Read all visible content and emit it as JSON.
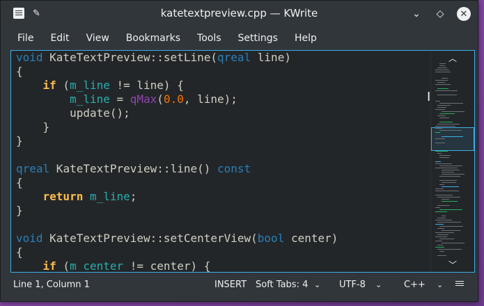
{
  "window": {
    "title": "katetextpreview.cpp  — KWrite",
    "icons": [
      "app-icon",
      "pin-icon",
      "chevron-down-icon",
      "restore-icon",
      "close-icon"
    ]
  },
  "menubar": {
    "items": [
      "File",
      "Edit",
      "View",
      "Bookmarks",
      "Tools",
      "Settings",
      "Help"
    ]
  },
  "editor": {
    "accent": "#3daee9",
    "lines": [
      [
        [
          "kw-blue",
          "void"
        ],
        [
          "plain",
          " KateTextPreview::setLine("
        ],
        [
          "kw-blue",
          "qreal"
        ],
        [
          "plain",
          " line)"
        ]
      ],
      [
        [
          "plain",
          "{"
        ]
      ],
      [
        [
          "plain",
          "    "
        ],
        [
          "kw-orange",
          "if"
        ],
        [
          "plain",
          " ("
        ],
        [
          "var",
          "m_line"
        ],
        [
          "plain",
          " != line) {"
        ]
      ],
      [
        [
          "plain",
          "        "
        ],
        [
          "var",
          "m_line"
        ],
        [
          "plain",
          " = "
        ],
        [
          "fn-purple",
          "qMax"
        ],
        [
          "plain",
          "("
        ],
        [
          "num",
          "0.0"
        ],
        [
          "plain",
          ", line);"
        ]
      ],
      [
        [
          "plain",
          "        update();"
        ]
      ],
      [
        [
          "plain",
          "    }"
        ]
      ],
      [
        [
          "plain",
          "}"
        ]
      ],
      [
        [
          "plain",
          ""
        ]
      ],
      [
        [
          "kw-blue",
          "qreal"
        ],
        [
          "plain",
          " KateTextPreview::line() "
        ],
        [
          "kw-blue",
          "const"
        ]
      ],
      [
        [
          "plain",
          "{"
        ]
      ],
      [
        [
          "plain",
          "    "
        ],
        [
          "kw-orange",
          "return"
        ],
        [
          "plain",
          " "
        ],
        [
          "var",
          "m_line"
        ],
        [
          "plain",
          ";"
        ]
      ],
      [
        [
          "plain",
          "}"
        ]
      ],
      [
        [
          "plain",
          ""
        ]
      ],
      [
        [
          "kw-blue",
          "void"
        ],
        [
          "plain",
          " KateTextPreview::setCenterView("
        ],
        [
          "kw-blue",
          "bool"
        ],
        [
          "plain",
          " center)"
        ]
      ],
      [
        [
          "plain",
          "{"
        ]
      ],
      [
        [
          "plain",
          "    "
        ],
        [
          "kw-orange",
          "if"
        ],
        [
          "plain",
          " ("
        ],
        [
          "var",
          "m_center"
        ],
        [
          "plain",
          " != center) {"
        ]
      ]
    ]
  },
  "statusbar": {
    "position": "Line 1, Column 1",
    "mode": "INSERT",
    "indent": "Soft Tabs: 4",
    "encoding": "UTF-8",
    "language": "C++"
  }
}
